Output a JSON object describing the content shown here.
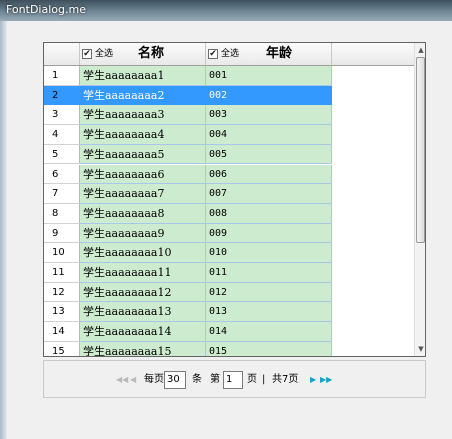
{
  "window": {
    "title": "FontDialog.me"
  },
  "grid": {
    "columns": [
      {
        "select_all_label": "全选",
        "title": "名称",
        "checked": true
      },
      {
        "select_all_label": "全选",
        "title": "年龄",
        "checked": true
      }
    ],
    "checkbox_mark": "✔",
    "rows": [
      {
        "idx": "1",
        "name": "学生aaaaaaaa1",
        "age": "001",
        "selected": false
      },
      {
        "idx": "2",
        "name": "学生aaaaaaaa2",
        "age": "002",
        "selected": true
      },
      {
        "idx": "3",
        "name": "学生aaaaaaaa3",
        "age": "003",
        "selected": false
      },
      {
        "idx": "4",
        "name": "学生aaaaaaaa4",
        "age": "004",
        "selected": false
      },
      {
        "idx": "5",
        "name": "学生aaaaaaaa5",
        "age": "005",
        "selected": false
      },
      {
        "idx": "6",
        "name": "学生aaaaaaaa6",
        "age": "006",
        "selected": false
      },
      {
        "idx": "7",
        "name": "学生aaaaaaaa7",
        "age": "007",
        "selected": false
      },
      {
        "idx": "8",
        "name": "学生aaaaaaaa8",
        "age": "008",
        "selected": false
      },
      {
        "idx": "9",
        "name": "学生aaaaaaaa9",
        "age": "009",
        "selected": false
      },
      {
        "idx": "10",
        "name": "学生aaaaaaaa10",
        "age": "010",
        "selected": false
      },
      {
        "idx": "11",
        "name": "学生aaaaaaaa11",
        "age": "011",
        "selected": false
      },
      {
        "idx": "12",
        "name": "学生aaaaaaaa12",
        "age": "012",
        "selected": false
      },
      {
        "idx": "13",
        "name": "学生aaaaaaaa13",
        "age": "013",
        "selected": false
      },
      {
        "idx": "14",
        "name": "学生aaaaaaaa14",
        "age": "014",
        "selected": false
      },
      {
        "idx": "15",
        "name": "学生aaaaaaaa15",
        "age": "015",
        "selected": false
      }
    ],
    "colors": {
      "cell_bg": "#cdeccf",
      "selected_bg": "#3399ff",
      "grid_line": "#a9c7e6"
    }
  },
  "pager": {
    "first_icon": "◀◀",
    "prev_icon": "◀",
    "next_icon": "▶",
    "last_icon": "▶▶",
    "per_page_prefix": "每页",
    "per_page_value": "30",
    "per_page_suffix": "条",
    "page_prefix": "第",
    "page_value": "1",
    "page_suffix": "页",
    "separator": "|",
    "total_pages": "共7页"
  }
}
